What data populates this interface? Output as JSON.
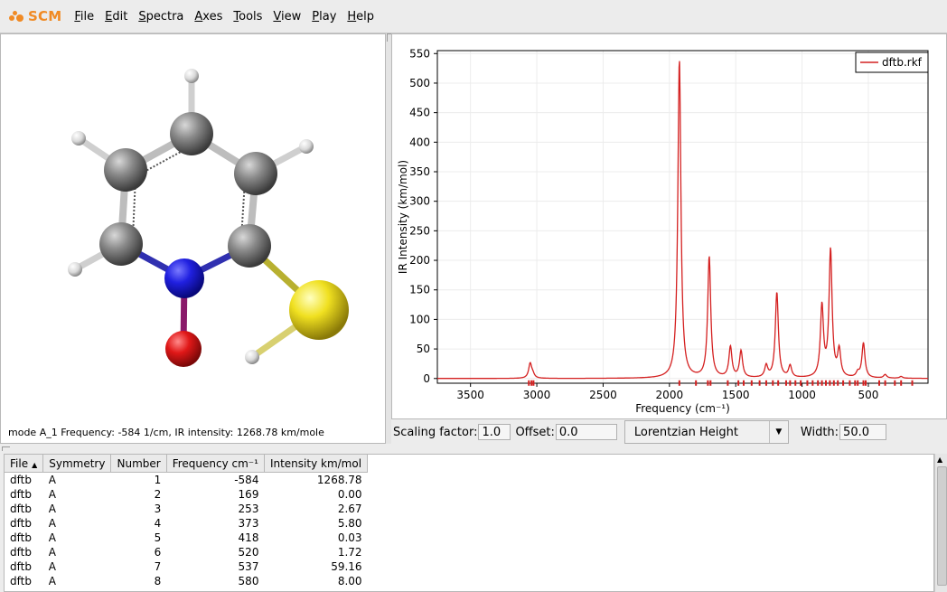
{
  "app": {
    "logo_text": "SCM"
  },
  "menu": [
    "File",
    "Edit",
    "Spectra",
    "Axes",
    "Tools",
    "View",
    "Play",
    "Help"
  ],
  "molecule_status": "mode A_1 Frequency: -584 1/cm, IR intensity: 1268.78 km/mole",
  "controls": {
    "scaling_label": "Scaling factor:",
    "scaling_value": "1.0",
    "offset_label": "Offset:",
    "offset_value": "0.0",
    "peak_type": "Lorentzian Height",
    "width_label": "Width:",
    "width_value": "50.0"
  },
  "table": {
    "columns": [
      "File",
      "Symmetry",
      "Number",
      "Frequency cm⁻¹",
      "Intensity km/mol"
    ],
    "sort_indicator": "▲",
    "rows": [
      [
        "dftb",
        "A",
        "1",
        "-584",
        "1268.78"
      ],
      [
        "dftb",
        "A",
        "2",
        "169",
        "0.00"
      ],
      [
        "dftb",
        "A",
        "3",
        "253",
        "2.67"
      ],
      [
        "dftb",
        "A",
        "4",
        "373",
        "5.80"
      ],
      [
        "dftb",
        "A",
        "5",
        "418",
        "0.03"
      ],
      [
        "dftb",
        "A",
        "6",
        "520",
        "1.72"
      ],
      [
        "dftb",
        "A",
        "7",
        "537",
        "59.16"
      ],
      [
        "dftb",
        "A",
        "8",
        "580",
        "8.00"
      ]
    ]
  },
  "colors": {
    "line": "#d42020",
    "logo": "#f08a24"
  },
  "chart_data": {
    "type": "line",
    "xlabel": "Frequency (cm⁻¹)",
    "ylabel": "IR Intensity (km/mol)",
    "xlim": [
      3750,
      50
    ],
    "ylim": [
      -8,
      555
    ],
    "x_reversed": true,
    "xticks": [
      3500,
      3000,
      2500,
      2000,
      1500,
      1000,
      500
    ],
    "yticks": [
      0,
      50,
      100,
      150,
      200,
      250,
      300,
      350,
      400,
      450,
      500,
      550
    ],
    "grid": true,
    "legend": "top-right",
    "series": [
      {
        "name": "dftb.rkf",
        "peak_shape": "lorentzian",
        "peak_width": 50,
        "peaks": [
          {
            "x": 3050,
            "y": 25
          },
          {
            "x": 3030,
            "y": 6
          },
          {
            "x": 1925,
            "y": 540
          },
          {
            "x": 1700,
            "y": 205
          },
          {
            "x": 1540,
            "y": 52
          },
          {
            "x": 1460,
            "y": 45
          },
          {
            "x": 1270,
            "y": 20
          },
          {
            "x": 1190,
            "y": 145
          },
          {
            "x": 1090,
            "y": 20
          },
          {
            "x": 850,
            "y": 120
          },
          {
            "x": 785,
            "y": 215
          },
          {
            "x": 720,
            "y": 45
          },
          {
            "x": 537,
            "y": 59
          },
          {
            "x": 580,
            "y": 8
          },
          {
            "x": 373,
            "y": 6
          },
          {
            "x": 253,
            "y": 3
          }
        ]
      }
    ],
    "stick_positions": [
      3060,
      3040,
      3025,
      1925,
      1800,
      1710,
      1690,
      1560,
      1480,
      1440,
      1380,
      1320,
      1270,
      1220,
      1180,
      1120,
      1090,
      1050,
      1010,
      960,
      920,
      880,
      850,
      820,
      790,
      760,
      730,
      690,
      640,
      600,
      580,
      537,
      520,
      418,
      373,
      300,
      253,
      169
    ]
  }
}
